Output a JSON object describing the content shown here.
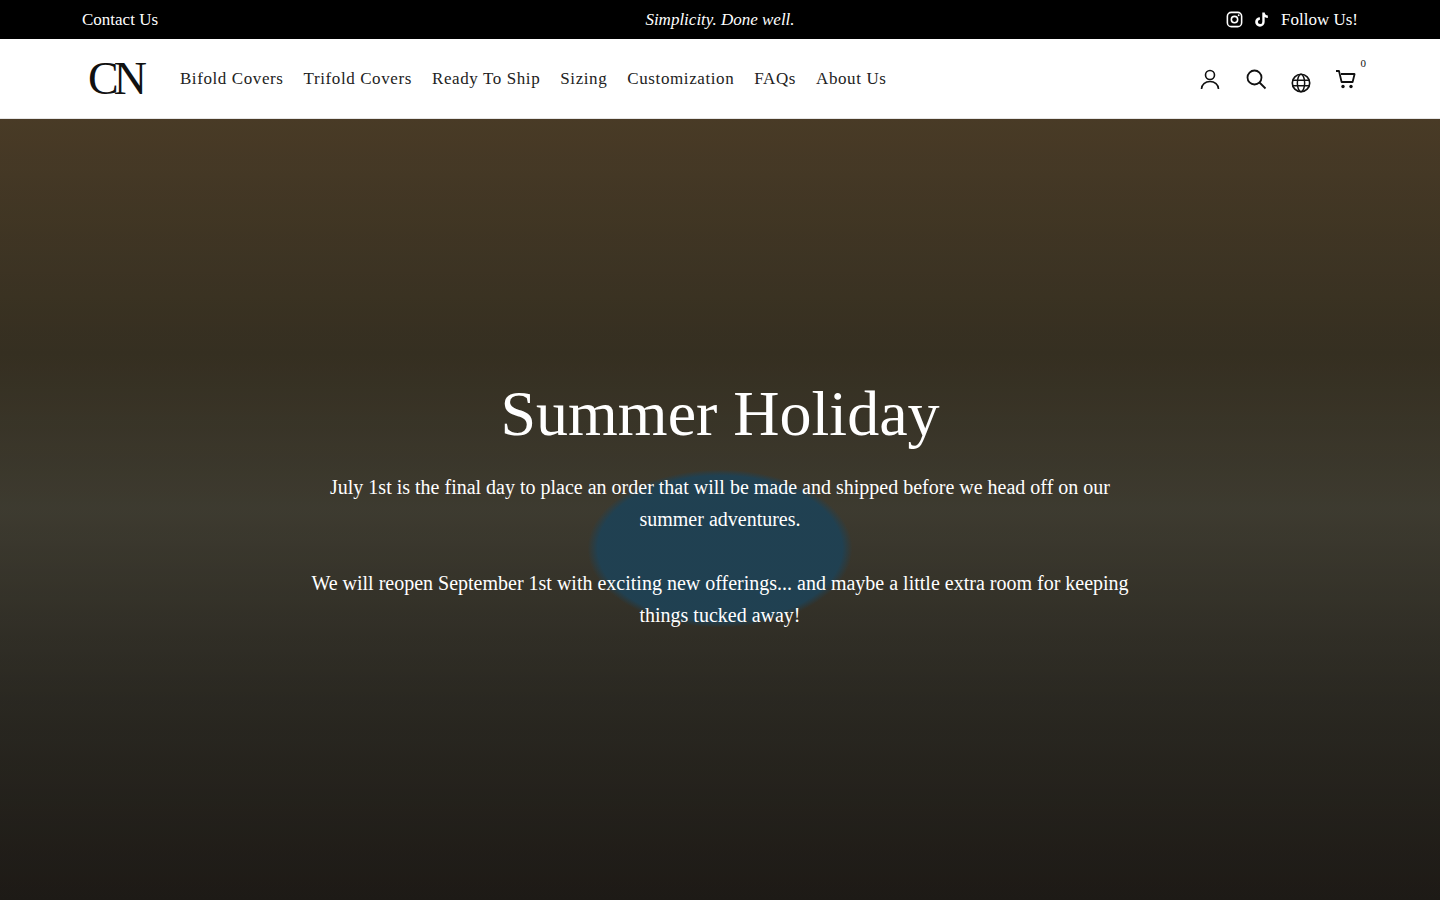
{
  "top_bar": {
    "contact": "Contact Us",
    "tagline": "Simplicity. Done well.",
    "follow": "Follow Us!"
  },
  "header": {
    "logo": "CN",
    "nav": [
      "Bifold Covers",
      "Trifold Covers",
      "Ready To Ship",
      "Sizing",
      "Customization",
      "FAQs",
      "About Us"
    ],
    "cart_count": "0"
  },
  "hero": {
    "title": "Summer Holiday",
    "paragraphs": [
      "July 1st is the final day to place an order that will be made and shipped before we head off on our summer adventures.",
      "We will reopen September 1st with exciting new offerings... and maybe a little extra room for keeping things tucked away!"
    ]
  }
}
